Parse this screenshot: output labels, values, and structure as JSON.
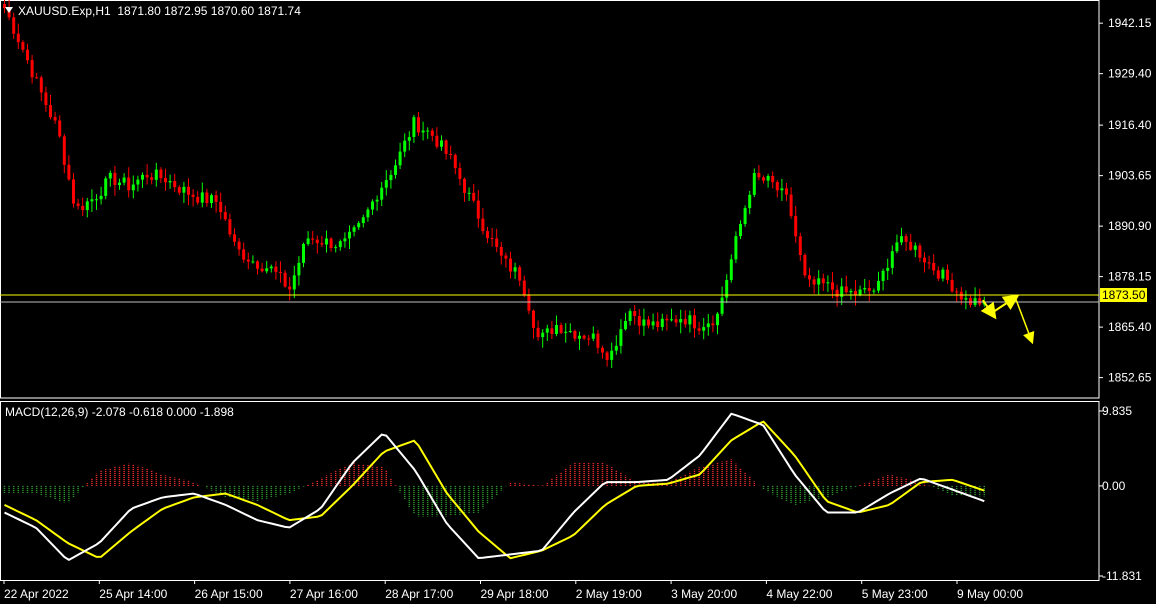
{
  "header": {
    "symbol": "XAUUSD.Exp,H1",
    "ohlc": "1871.80 1872.95 1870.60 1871.74"
  },
  "macd_header": "MACD(12,26,9) -2.078 -0.618 0.000 -1.898",
  "current_price_label": "1873.50",
  "colors": {
    "background": "#000000",
    "bull_candle": "#00ff00",
    "bear_candle": "#ff0000",
    "macd_line": "#ffffff",
    "signal_line": "#ffff00",
    "hist_pos": "#ff3030",
    "hist_neg": "#2ea82e",
    "level_line": "#ffff00",
    "arrow": "#ffff00",
    "axis": "#ffffff"
  },
  "chart_data": [
    {
      "type": "candlestick",
      "panel": "price",
      "y_ticks": [
        "1942.15",
        "1929.40",
        "1916.40",
        "1903.65",
        "1890.90",
        "1878.15",
        "1865.40",
        "1852.65"
      ],
      "ylim": [
        1847.5,
        1948.0
      ],
      "x_ticks": [
        "22 Apr 2022",
        "25 Apr 14:00",
        "26 Apr 15:00",
        "27 Apr 16:00",
        "28 Apr 17:00",
        "29 Apr 18:00",
        "2 May 19:00",
        "3 May 20:00",
        "4 May 22:00",
        "5 May 23:00",
        "9 May 00:00"
      ],
      "close_anchors": [
        1946,
        1936,
        1925,
        1915,
        1895,
        1898,
        1903,
        1901,
        1904,
        1903,
        1900,
        1898,
        1897,
        1885,
        1882,
        1880,
        1875,
        1888,
        1887,
        1886,
        1891,
        1900,
        1907,
        1917,
        1914,
        1908,
        1899,
        1890,
        1882,
        1878,
        1862,
        1866,
        1864,
        1863,
        1858,
        1870,
        1866,
        1866,
        1868,
        1866,
        1868,
        1886,
        1903,
        1902,
        1897,
        1876,
        1876,
        1874,
        1874,
        1875,
        1887,
        1886,
        1881,
        1877,
        1872,
        1871.74
      ],
      "current_price_level": 1873.5,
      "current_bid_level": 1871.74,
      "projection_arrows": [
        [
          1872.2,
          1869.0,
          1872.5
        ],
        [
          1872.5,
          1862.5
        ]
      ]
    },
    {
      "type": "macd",
      "panel": "indicator",
      "params": "12,26,9",
      "y_ticks": [
        "9.835",
        "0.00",
        "-11.831"
      ],
      "ylim": [
        -11.831,
        9.835
      ],
      "macd_anchors": [
        -3.5,
        -5.5,
        -9.8,
        -7.5,
        -3.0,
        -1.5,
        -1.0,
        -2.5,
        -4.5,
        -5.5,
        -3.0,
        3.0,
        7.0,
        2.0,
        -5.0,
        -9.5,
        -9.0,
        -8.5,
        -3.5,
        0.5,
        0.5,
        0.8,
        4.0,
        9.5,
        8.0,
        1.5,
        -3.5,
        -3.5,
        -1.0,
        1.0,
        -0.5,
        -2.0
      ],
      "signal_anchors": [
        -2.5,
        -4.5,
        -7.5,
        -9.5,
        -6.0,
        -3.0,
        -1.5,
        -1.0,
        -2.5,
        -4.5,
        -4.0,
        0.0,
        4.5,
        6.0,
        -1.0,
        -6.0,
        -9.5,
        -8.5,
        -6.5,
        -2.5,
        0.0,
        0.3,
        1.5,
        6.0,
        8.5,
        4.0,
        -2.0,
        -3.5,
        -2.5,
        0.5,
        0.8,
        -0.618
      ]
    }
  ]
}
